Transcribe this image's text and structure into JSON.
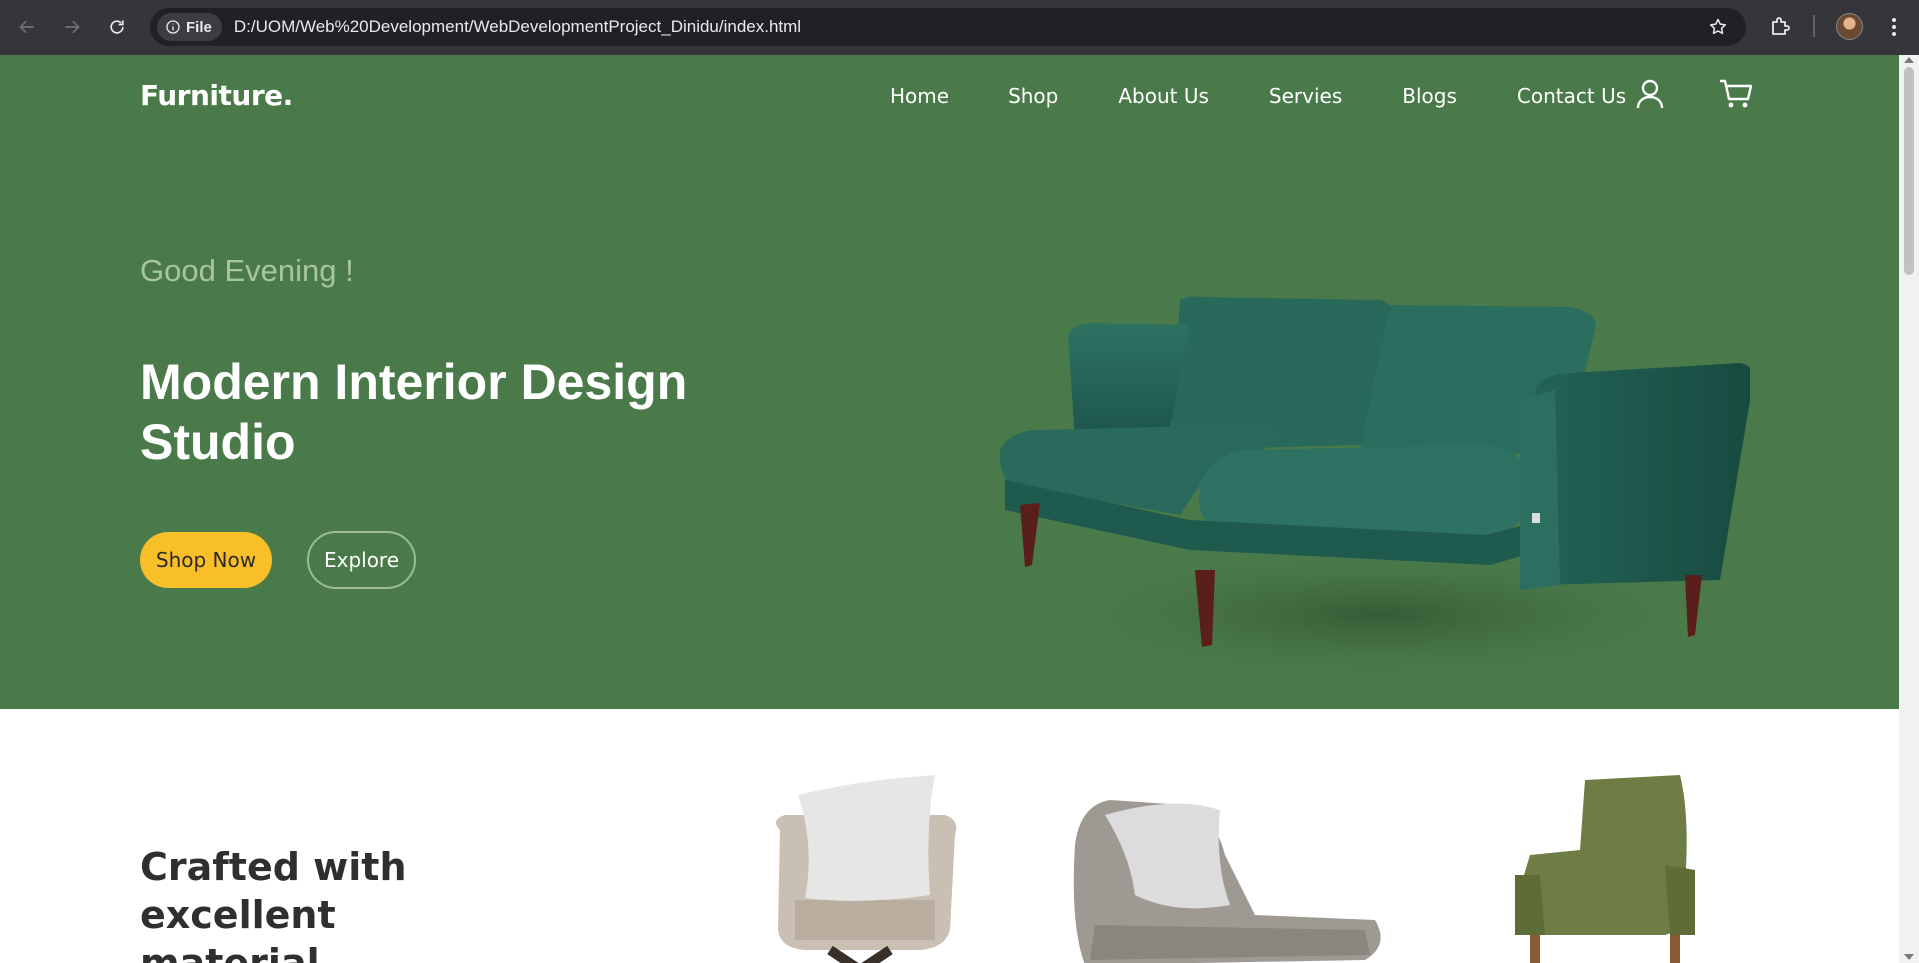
{
  "browser": {
    "file_chip_label": "File",
    "url": "D:/UOM/Web%20Development/WebDevelopmentProject_Dinidu/index.html"
  },
  "header": {
    "logo": "Furniture.",
    "nav": [
      "Home",
      "Shop",
      "About Us",
      "Servies",
      "Blogs",
      "Contact Us"
    ],
    "icons": [
      "user-icon",
      "cart-icon"
    ]
  },
  "hero": {
    "greeting": "Good Evening !",
    "title": "Modern Interior Design Studio",
    "shop_button": "Shop Now",
    "explore_button": "Explore"
  },
  "section2": {
    "title": "Crafted with excellent material."
  },
  "colors": {
    "hero_bg": "#4a7a4a",
    "accent": "#f9bf29",
    "chrome_bg": "#35363a"
  }
}
